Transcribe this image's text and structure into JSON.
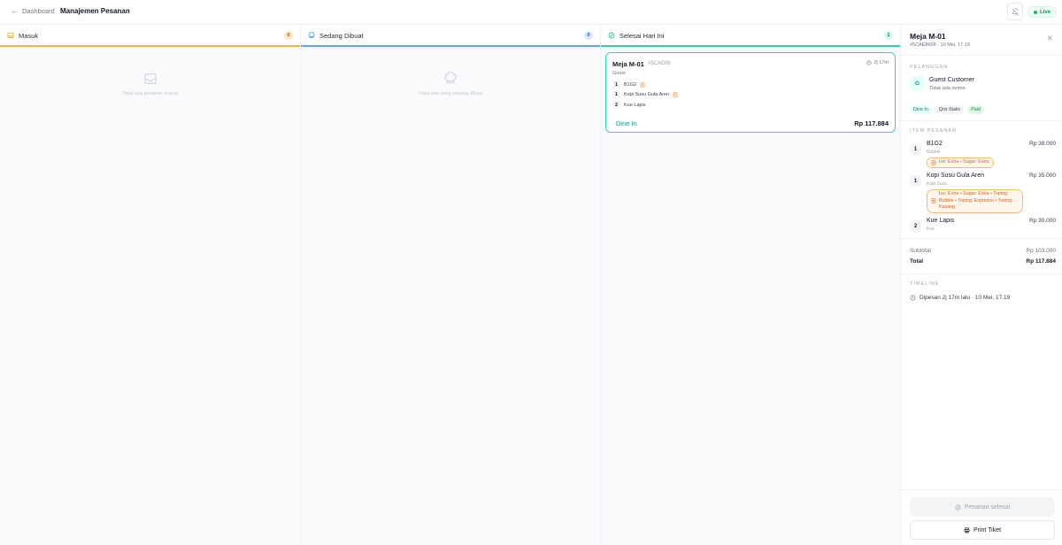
{
  "header": {
    "back_label": "Dashboard",
    "title": "Manajemen Pesanan",
    "live_label": "Live"
  },
  "columns": [
    {
      "title": "Masuk",
      "count": "0",
      "empty_text": "Tidak ada pesanan masuk",
      "accent": "#f5b041"
    },
    {
      "title": "Sedang Dibuat",
      "count": "0",
      "empty_text": "Tidak ada yang sedang dibuat",
      "accent": "#60a5fa"
    },
    {
      "title": "Selesai Hari Ini",
      "count": "1",
      "accent": "#34d399"
    }
  ],
  "card": {
    "table": "Meja M-01",
    "code": "#5CAE86",
    "elapsed": "2j 17m",
    "customer": "Guest",
    "items": [
      {
        "qty": "1",
        "name": "B1G2",
        "has_note": true
      },
      {
        "qty": "1",
        "name": "Kopi Susu Gula Aren",
        "has_note": true
      },
      {
        "qty": "2",
        "name": "Kue Lapis",
        "has_note": false
      }
    ],
    "type": "Dine In",
    "total": "Rp 117.884"
  },
  "detail": {
    "title": "Meja M-01",
    "subtitle": "#5CAE8608 · 10 Mei, 17.19",
    "customer_section": "Pelanggan",
    "avatar_initial": "G",
    "customer_name": "Guest Customer",
    "customer_phone": "Tidak ada nomor",
    "tags": [
      "Dine In",
      "Qris Static",
      "Paid"
    ],
    "items_section": "Item Pesanan",
    "items": [
      {
        "qty": "1",
        "name": "B1G2",
        "category": "Bubble",
        "price": "Rp 38.000",
        "note": "Ice: Extra • Sugar: Extra"
      },
      {
        "qty": "1",
        "name": "Kopi Susu Gula Aren",
        "category": "Kopi Susu",
        "price": "Rp 35.000",
        "note": "Ice: Extra • Sugar: Extra • Toping: Bubble • Toping: Espresso • Toping: Kacang"
      },
      {
        "qty": "2",
        "name": "Kue Lapis",
        "category": "Kue",
        "price": "Rp 30.000"
      }
    ],
    "subtotal_label": "Subtotal",
    "subtotal_value": "Rp 103.000",
    "total_label": "Total",
    "total_value": "Rp 117.884",
    "timeline_section": "Timeline",
    "timeline_entry": "Dipesan 2j 17m lalu · 10 Mei, 17.19",
    "done_button": "Pesanan selesai",
    "print_button": "Print Tiket"
  }
}
